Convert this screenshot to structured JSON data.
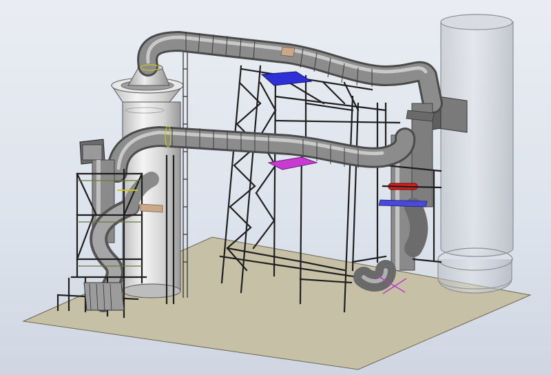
{
  "view": {
    "background": "#dde3ec",
    "floor_color": "#c6c0a6",
    "duct_color": "#8c8c8c",
    "steel_color": "#1e1e1e",
    "platform_blue": "#2f2fd6",
    "platform_magenta": "#c73bd0",
    "damper_red": "#d62020",
    "stack_glass": "#bfc3c8"
  },
  "components": [
    "floor-slab",
    "glass-stack",
    "cyclone-separator",
    "upper-duct",
    "lower-duct",
    "central-support-tower",
    "left-support-frame",
    "right-riser-duct",
    "blue-platform",
    "magenta-platform",
    "red-damper-ring"
  ]
}
